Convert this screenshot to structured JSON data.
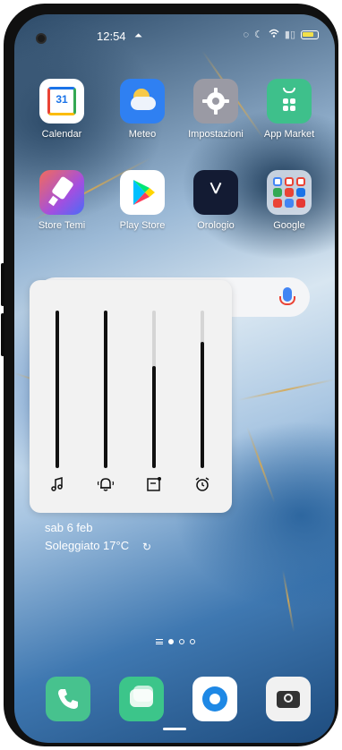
{
  "status_bar": {
    "time": "12:54",
    "icons": [
      "camera-punch-hole",
      "notification-icon",
      "alarm-icon",
      "moon-icon",
      "wifi-icon",
      "signal-icon",
      "battery-icon"
    ]
  },
  "apps_row1": [
    {
      "label": "Calendar",
      "icon": "calendar-icon",
      "badge": "31"
    },
    {
      "label": "Meteo",
      "icon": "weather-icon"
    },
    {
      "label": "Impostazioni",
      "icon": "settings-gear-icon"
    },
    {
      "label": "App Market",
      "icon": "app-market-icon"
    }
  ],
  "apps_row2": [
    {
      "label": "Store Temi",
      "icon": "theme-store-icon"
    },
    {
      "label": "Play Store",
      "icon": "play-store-icon"
    },
    {
      "label": "Orologio",
      "icon": "clock-icon"
    },
    {
      "label": "Google",
      "icon": "google-folder-icon"
    }
  ],
  "search": {
    "icon": "mic-icon"
  },
  "volume_panel": {
    "sliders": [
      {
        "name": "media",
        "icon": "music-note-icon",
        "level": 1.0
      },
      {
        "name": "ringtone",
        "icon": "ringer-bell-icon",
        "level": 1.0
      },
      {
        "name": "notifications",
        "icon": "notification-square-icon",
        "level": 0.65
      },
      {
        "name": "alarm",
        "icon": "alarm-clock-icon",
        "level": 0.8
      }
    ]
  },
  "weather_widget": {
    "date": "sab 6 feb",
    "condition": "Soleggiato 17°C",
    "refresh_icon": "refresh-icon"
  },
  "pager": {
    "pages": 3,
    "active": 0
  },
  "dock": [
    {
      "name": "phone",
      "icon": "phone-icon",
      "color": "#47c28e"
    },
    {
      "name": "messages",
      "icon": "messages-icon",
      "color": "#3cc58a"
    },
    {
      "name": "browser",
      "icon": "browser-icon",
      "color": "#1e88e5"
    },
    {
      "name": "camera",
      "icon": "camera-icon",
      "color": "#f1f1f1"
    }
  ]
}
